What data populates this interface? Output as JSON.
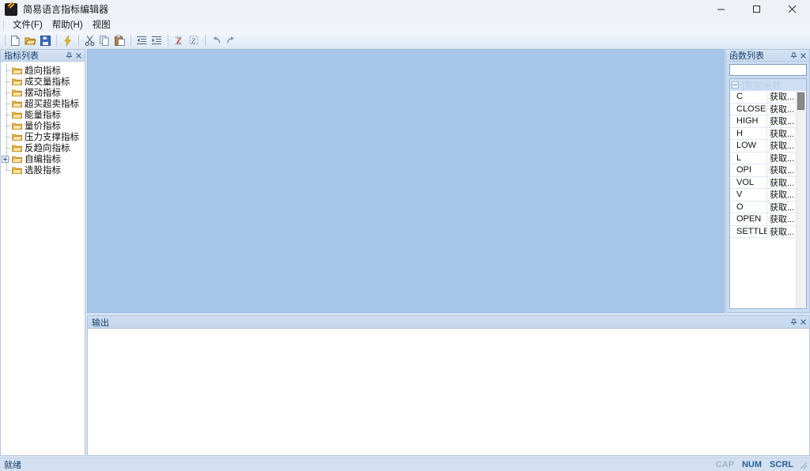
{
  "window": {
    "title": "简易语言指标编辑器",
    "icon": "pencil-icon",
    "minimize_label": "最小化",
    "maximize_label": "最大化",
    "close_label": "关闭"
  },
  "menu": {
    "items": [
      {
        "label": "文件(F)",
        "text": "文件",
        "accel": "F"
      },
      {
        "label": "帮助(H)",
        "text": "帮助",
        "accel": "H"
      },
      {
        "label": "视图",
        "text": "视图",
        "accel": ""
      }
    ]
  },
  "toolbar": {
    "buttons": [
      {
        "name": "new-file-button",
        "icon": "new-document-icon",
        "tooltip": "新建"
      },
      {
        "name": "open-file-button",
        "icon": "open-folder-icon",
        "tooltip": "打开"
      },
      {
        "name": "save-file-button",
        "icon": "floppy-save-icon",
        "tooltip": "保存"
      },
      {
        "name": "compile-button",
        "icon": "lightning-bolt-icon",
        "tooltip": "编译"
      },
      {
        "name": "cut-button",
        "icon": "scissors-icon",
        "tooltip": "剪切"
      },
      {
        "name": "copy-button",
        "icon": "copy-icon",
        "tooltip": "复制"
      },
      {
        "name": "paste-button",
        "icon": "paste-icon",
        "tooltip": "粘贴"
      },
      {
        "name": "outdent-button",
        "icon": "decrease-indent-icon",
        "tooltip": "减少缩进"
      },
      {
        "name": "indent-button",
        "icon": "increase-indent-icon",
        "tooltip": "增加缩进"
      },
      {
        "name": "comment-button",
        "icon": "comment-icon",
        "tooltip": "注释"
      },
      {
        "name": "uncomment-button",
        "icon": "uncomment-icon",
        "tooltip": "取消注释"
      },
      {
        "name": "undo-button",
        "icon": "undo-arrow-icon",
        "tooltip": "撤销"
      },
      {
        "name": "redo-button",
        "icon": "redo-arrow-icon",
        "tooltip": "重做"
      }
    ]
  },
  "left_panel": {
    "title": "指标列表",
    "pin_icon": "pin-icon",
    "close_icon": "close-icon",
    "tree": [
      {
        "label": "趋向指标",
        "expandable": false
      },
      {
        "label": "成交量指标",
        "expandable": false
      },
      {
        "label": "摆动指标",
        "expandable": false
      },
      {
        "label": "超买超卖指标",
        "expandable": false
      },
      {
        "label": "能量指标",
        "expandable": false
      },
      {
        "label": "量价指标",
        "expandable": false
      },
      {
        "label": "压力支撑指标",
        "expandable": false
      },
      {
        "label": "反趋向指标",
        "expandable": false
      },
      {
        "label": "自编指标",
        "expandable": true
      },
      {
        "label": "选股指标",
        "expandable": false
      }
    ]
  },
  "editor": {
    "content": "",
    "background": "#a8c6ea"
  },
  "right_panel": {
    "title": "函数列表",
    "pin_icon": "pin-icon",
    "close_icon": "close-icon",
    "search": {
      "value": "",
      "placeholder": ""
    },
    "group_label": "[数据函数",
    "functions": [
      {
        "name": "C",
        "desc": "获取..."
      },
      {
        "name": "CLOSE",
        "desc": "获取..."
      },
      {
        "name": "HIGH",
        "desc": "获取..."
      },
      {
        "name": "H",
        "desc": "获取..."
      },
      {
        "name": "LOW",
        "desc": "获取..."
      },
      {
        "name": "L",
        "desc": "获取..."
      },
      {
        "name": "OPI",
        "desc": "获取..."
      },
      {
        "name": "VOL",
        "desc": "获取..."
      },
      {
        "name": "V",
        "desc": "获取..."
      },
      {
        "name": "O",
        "desc": "获取..."
      },
      {
        "name": "OPEN",
        "desc": "获取..."
      },
      {
        "name": "SETTLE",
        "desc": "获取..."
      }
    ]
  },
  "output_panel": {
    "title": "输出",
    "pin_icon": "pin-icon",
    "close_icon": "close-icon",
    "content": ""
  },
  "statusbar": {
    "message": "就绪",
    "indicators": [
      {
        "label": "CAP",
        "active": false
      },
      {
        "label": "NUM",
        "active": true
      },
      {
        "label": "SCRL",
        "active": true
      }
    ]
  },
  "colors": {
    "titlebar": "#eef2f7",
    "chrome": "#d6e3f3",
    "editor": "#a8c6ea",
    "caption": "#cfdef1",
    "accent": "#17406d"
  }
}
